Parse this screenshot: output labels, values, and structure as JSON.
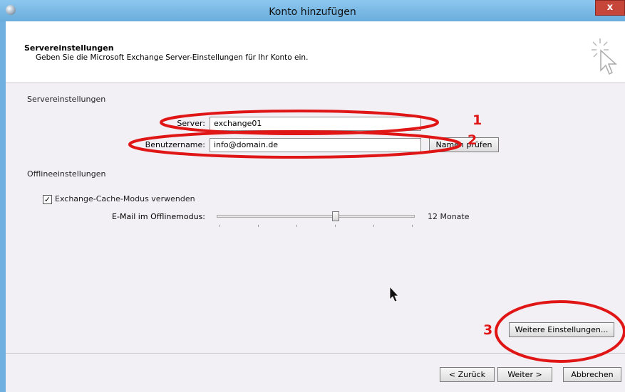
{
  "window": {
    "title": "Konto hinzufügen",
    "close_label": "x"
  },
  "header": {
    "title": "Servereinstellungen",
    "subtitle": "Geben Sie die Microsoft Exchange Server-Einstellungen für Ihr Konto ein."
  },
  "server_section": {
    "group_label": "Servereinstellungen",
    "server_label": "Server:",
    "server_value": "exchange01",
    "username_label": "Benutzername:",
    "username_value": "info@domain.de",
    "check_names_label": "Namen prüfen"
  },
  "offline_section": {
    "group_label": "Offlineeinstellungen",
    "cache_mode_label": "Exchange-Cache-Modus verwenden",
    "cache_mode_checked": true,
    "offline_mail_label": "E-Mail im Offlinemodus:",
    "offline_mail_value": "12 Monate",
    "slider_level": 0.6
  },
  "more_settings_label": "Weitere Einstellungen...",
  "footer": {
    "back_label": "< Zurück",
    "next_label": "Weiter >",
    "cancel_label": "Abbrechen"
  },
  "annotations": {
    "one": "1",
    "two": "2",
    "three": "3",
    "color": "#e01515"
  }
}
